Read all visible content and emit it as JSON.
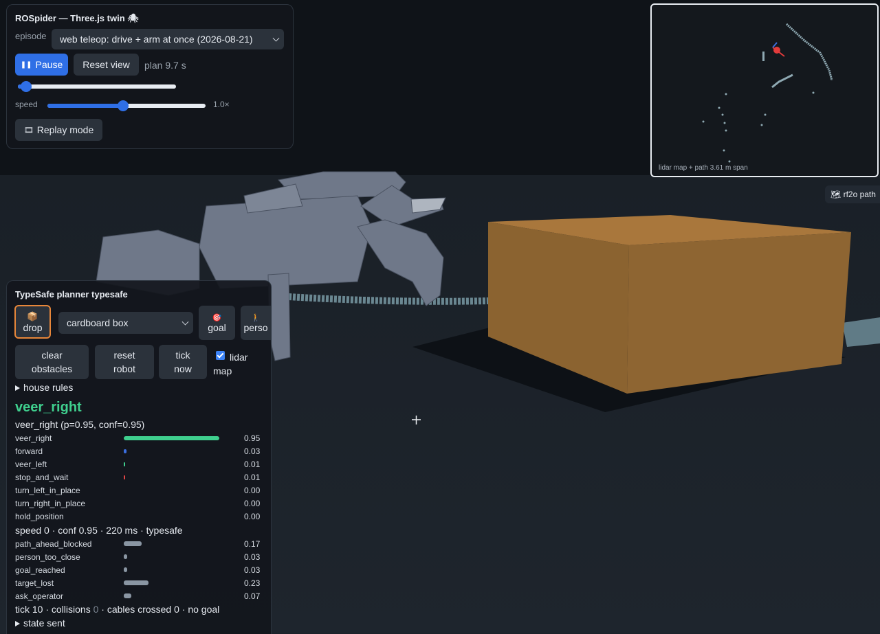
{
  "top_panel": {
    "title": "ROSpider — Three.js twin 🕷",
    "episode_label": "episode",
    "episode_value": "web teleop: drive + arm at once (2026-08-21)",
    "pause_label": "Pause",
    "reset_view_label": "Reset view",
    "plan_text": "plan 9.7 s",
    "timeline_fraction": 0.05,
    "speed_label": "speed",
    "speed_value": "1.0×",
    "speed_fraction": 0.48,
    "replay_label": "Replay mode"
  },
  "minimap": {
    "caption": "lidar map + path  3.61 m span"
  },
  "rf2o_label": "🗺 rf2o path",
  "planner": {
    "title": "TypeSafe planner typesafe",
    "drop_label": "drop",
    "object_select": "cardboard box",
    "goal_label": "goal",
    "person_label": "perso",
    "clear_label": "clear obstacles",
    "reset_robot_label": "reset robot",
    "tick_now_label": "tick now",
    "lidar_map_label": "lidar map",
    "house_rules_label": "house rules",
    "action_title": "veer_right",
    "action_detail": "veer_right (p=0.95, conf=0.95)",
    "actions": [
      {
        "name": "veer_right",
        "value": "0.95",
        "p": 0.95,
        "color": "#3fcf8e"
      },
      {
        "name": "forward",
        "value": "0.03",
        "p": 0.03,
        "color": "#3b6fe0"
      },
      {
        "name": "veer_left",
        "value": "0.01",
        "p": 0.01,
        "color": "#3fcf8e"
      },
      {
        "name": "stop_and_wait",
        "value": "0.01",
        "p": 0.01,
        "color": "#e04545"
      },
      {
        "name": "turn_left_in_place",
        "value": "0.00",
        "p": 0.0,
        "color": "#8a96a3"
      },
      {
        "name": "turn_right_in_place",
        "value": "0.00",
        "p": 0.0,
        "color": "#8a96a3"
      },
      {
        "name": "hold_position",
        "value": "0.00",
        "p": 0.0,
        "color": "#8a96a3"
      }
    ],
    "status_line": "speed 0 · conf 0.95 · 220 ms · typesafe",
    "predicates": [
      {
        "name": "path_ahead_blocked",
        "value": "0.17",
        "p": 0.17
      },
      {
        "name": "person_too_close",
        "value": "0.03",
        "p": 0.03
      },
      {
        "name": "goal_reached",
        "value": "0.03",
        "p": 0.03
      },
      {
        "name": "target_lost",
        "value": "0.23",
        "p": 0.23
      },
      {
        "name": "ask_operator",
        "value": "0.07",
        "p": 0.07
      }
    ],
    "tick_line_a": "tick 10 · collisions ",
    "tick_collisions": "0",
    "tick_line_b": " · cables crossed 0 · no goal",
    "state_sent_label": "state sent"
  },
  "colors": {
    "accent": "#2f6fe6",
    "action_title": "#3fcf8e",
    "drop_border": "#e8873a",
    "box_top": "#a9773c",
    "box_front": "#8b6330",
    "box_side": "#7a5629"
  }
}
